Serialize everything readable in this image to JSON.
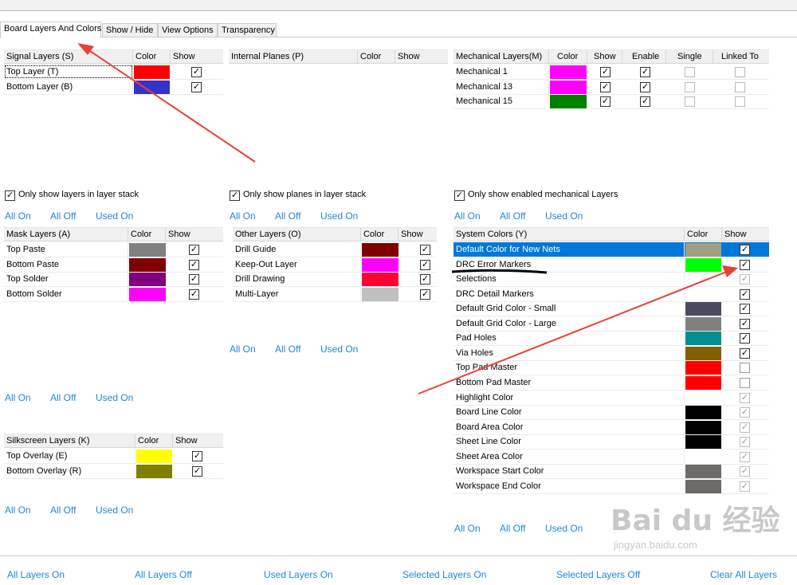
{
  "tabs": [
    "Board Layers And Colors",
    "Show / Hide",
    "View Options",
    "Transparency"
  ],
  "link_labels": {
    "all_on": "All On",
    "all_off": "All Off",
    "used_on": "Used On"
  },
  "signal": {
    "headers": [
      "Signal Layers (S)",
      "Color",
      "Show"
    ],
    "rows": [
      {
        "name": "Top Layer (T)",
        "color": "#ff0000",
        "show": true
      },
      {
        "name": "Bottom Layer (B)",
        "color": "#3333cc",
        "show": true
      }
    ],
    "option": "Only show layers in layer stack"
  },
  "internal": {
    "headers": [
      "Internal Planes (P)",
      "Color",
      "Show"
    ],
    "option": "Only show planes in layer stack"
  },
  "mechanical": {
    "headers": [
      "Mechanical Layers(M)",
      "Color",
      "Show",
      "Enable",
      "Single",
      "Linked To"
    ],
    "rows": [
      {
        "name": "Mechanical 1",
        "color": "#ff00ff",
        "show": true,
        "enable": true,
        "single": false,
        "linked": false
      },
      {
        "name": "Mechanical 13",
        "color": "#ff00ff",
        "show": true,
        "enable": true,
        "single": false,
        "linked": false
      },
      {
        "name": "Mechanical 15",
        "color": "#008000",
        "show": true,
        "enable": true,
        "single": false,
        "linked": false
      }
    ],
    "option": "Only show enabled mechanical Layers"
  },
  "mask": {
    "headers": [
      "Mask Layers (A)",
      "Color",
      "Show"
    ],
    "rows": [
      {
        "name": "Top Paste",
        "color": "#808080",
        "show": true
      },
      {
        "name": "Bottom Paste",
        "color": "#800000",
        "show": true
      },
      {
        "name": "Top Solder",
        "color": "#800080",
        "show": true
      },
      {
        "name": "Bottom Solder",
        "color": "#ff00ff",
        "show": true
      }
    ]
  },
  "other": {
    "headers": [
      "Other Layers (O)",
      "Color",
      "Show"
    ],
    "rows": [
      {
        "name": "Drill Guide",
        "color": "#800000",
        "show": true
      },
      {
        "name": "Keep-Out Layer",
        "color": "#ff00ff",
        "show": true
      },
      {
        "name": "Drill Drawing",
        "color": "#ff0033",
        "show": true
      },
      {
        "name": "Multi-Layer",
        "color": "#c0c0c0",
        "show": true
      }
    ]
  },
  "silkscreen": {
    "headers": [
      "Silkscreen Layers (K)",
      "Color",
      "Show"
    ],
    "rows": [
      {
        "name": "Top Overlay (E)",
        "color": "#ffff00",
        "show": true
      },
      {
        "name": "Bottom Overlay (R)",
        "color": "#808000",
        "show": true
      }
    ]
  },
  "system": {
    "headers": [
      "System Colors (Y)",
      "Color",
      "Show"
    ],
    "rows": [
      {
        "name": "Default Color for New Nets",
        "color": "#a0a080",
        "show": true,
        "state": "on",
        "selected": true
      },
      {
        "name": "DRC Error Markers",
        "color": "#00ff00",
        "show": true,
        "state": "on"
      },
      {
        "name": "Selections",
        "color": "",
        "show": true,
        "state": "disabled"
      },
      {
        "name": "DRC Detail Markers",
        "color": "",
        "show": true,
        "state": "on"
      },
      {
        "name": "Default Grid Color - Small",
        "color": "#4a4a60",
        "show": true,
        "state": "on"
      },
      {
        "name": "Default Grid Color - Large",
        "color": "#808080",
        "show": true,
        "state": "on"
      },
      {
        "name": "Pad Holes",
        "color": "#008f8f",
        "show": true,
        "state": "on"
      },
      {
        "name": "Via Holes",
        "color": "#806000",
        "show": true,
        "state": "on"
      },
      {
        "name": "Top Pad Master",
        "color": "#ff0000",
        "show": false,
        "state": "off"
      },
      {
        "name": "Bottom Pad Master",
        "color": "#ff0000",
        "show": false,
        "state": "off"
      },
      {
        "name": "Highlight Color",
        "color": "",
        "show": true,
        "state": "disabled"
      },
      {
        "name": "Board Line Color",
        "color": "#000000",
        "show": true,
        "state": "disabled"
      },
      {
        "name": "Board Area Color",
        "color": "#000000",
        "show": true,
        "state": "disabled"
      },
      {
        "name": "Sheet Line Color",
        "color": "#000000",
        "show": true,
        "state": "disabled"
      },
      {
        "name": "Sheet Area Color",
        "color": "",
        "show": true,
        "state": "disabled"
      },
      {
        "name": "Workspace Start Color",
        "color": "#6e6a6a",
        "show": true,
        "state": "disabled"
      },
      {
        "name": "Workspace End Color",
        "color": "#6e6a6a",
        "show": true,
        "state": "disabled"
      }
    ]
  },
  "bottom_buttons": [
    "All Layers On",
    "All Layers Off",
    "Used Layers On",
    "Selected Layers On",
    "Selected Layers Off",
    "Clear All Layers"
  ],
  "watermark": {
    "text": "Bai du 经验",
    "url": "jingyan.baidu.com"
  },
  "colors": {
    "link": "#1e88d8",
    "selection": "#0078d7",
    "annotation_arrow": "#e8403a"
  }
}
